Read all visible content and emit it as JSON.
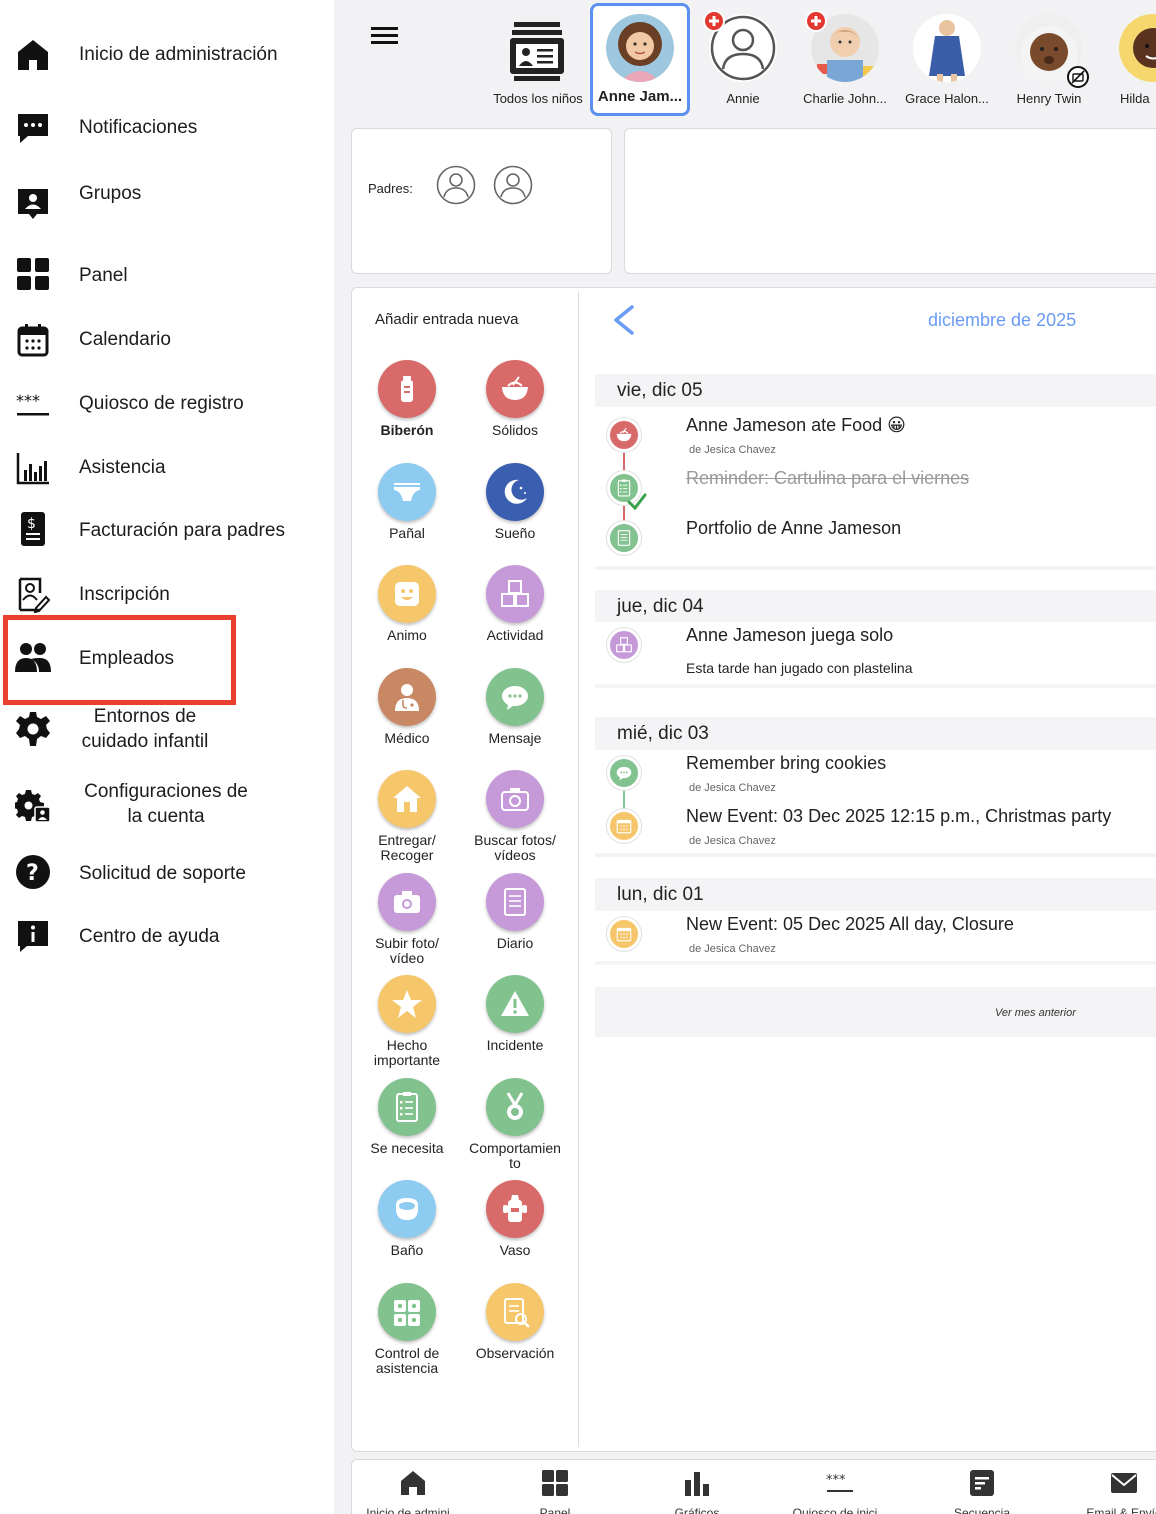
{
  "sidebar": {
    "items": [
      {
        "label": "Inicio de administración",
        "icon": "home-icon"
      },
      {
        "label": "Notificaciones",
        "icon": "chat-bubble-icon"
      },
      {
        "label": "Grupos",
        "icon": "group-badge-icon"
      },
      {
        "label": "Panel",
        "icon": "grid-icon"
      },
      {
        "label": "Calendario",
        "icon": "calendar-icon"
      },
      {
        "label": "Quiosco de registro",
        "icon": "asterisks-icon"
      },
      {
        "label": "Asistencia",
        "icon": "bar-chart-icon"
      },
      {
        "label": "Facturación para padres",
        "icon": "invoice-icon"
      },
      {
        "label": "Inscripción",
        "icon": "enrollment-icon"
      },
      {
        "label": "Empleados",
        "icon": "people-icon"
      },
      {
        "label_line1": "Entornos de",
        "label_line2": "cuidado infantil",
        "icon": "gear-icon"
      },
      {
        "label_line1": "Configuraciones de",
        "label_line2": "la cuenta",
        "icon": "account-settings-icon"
      },
      {
        "label": "Solicitud de soporte",
        "icon": "question-icon"
      },
      {
        "label": "Centro de ayuda",
        "icon": "info-icon"
      }
    ],
    "highlight_color": "#e8402c"
  },
  "children_bar": {
    "tabs": [
      {
        "name": "Todos los niños",
        "kind": "all"
      },
      {
        "name": "Anne Jam...",
        "kind": "photo",
        "selected": true
      },
      {
        "name": "Annie",
        "kind": "placeholder",
        "badge": true
      },
      {
        "name": "Charlie John...",
        "kind": "photo",
        "badge": true
      },
      {
        "name": "Grace Halon...",
        "kind": "photo"
      },
      {
        "name": "Henry Twin",
        "kind": "photo"
      },
      {
        "name": "Hilda",
        "kind": "photo"
      }
    ],
    "selected_color": "#5b8ff0"
  },
  "parents": {
    "label": "Padres:"
  },
  "add_entry": {
    "title": "Añadir entrada nueva",
    "items": [
      {
        "label": "Biberón",
        "color": "#d96a6a",
        "icon": "bottle-icon",
        "bold": true
      },
      {
        "label": "Sólidos",
        "color": "#d96a6a",
        "icon": "bowl-icon"
      },
      {
        "label": "Pañal",
        "color": "#8ecbf0",
        "icon": "diaper-icon"
      },
      {
        "label": "Sueño",
        "color": "#3a5fb0",
        "icon": "moon-icon"
      },
      {
        "label": "Animo",
        "color": "#f5c66a",
        "icon": "smile-icon"
      },
      {
        "label": "Actividad",
        "color": "#c69ad8",
        "icon": "blocks-icon"
      },
      {
        "label": "Médico",
        "color": "#c98864",
        "icon": "doctor-icon"
      },
      {
        "label": "Mensaje",
        "color": "#82c28e",
        "icon": "message-icon"
      },
      {
        "label_line1": "Entregar/",
        "label_line2": "Recoger",
        "color": "#f5c66a",
        "icon": "house-icon"
      },
      {
        "label_line1": "Buscar fotos/",
        "label_line2": "vídeos",
        "color": "#c69ad8",
        "icon": "camera-icon"
      },
      {
        "label_line1": "Subir foto/",
        "label_line2": "vídeo",
        "color": "#c69ad8",
        "icon": "camera-upload-icon"
      },
      {
        "label": "Diario",
        "color": "#c69ad8",
        "icon": "journal-icon"
      },
      {
        "label_line1": "Hecho",
        "label_line2": "importante",
        "color": "#f5c66a",
        "icon": "star-icon"
      },
      {
        "label": "Incidente",
        "color": "#82c28e",
        "icon": "warning-icon"
      },
      {
        "label": "Se necesita",
        "color": "#82c28e",
        "icon": "checklist-icon"
      },
      {
        "label_line1": "Comportamien",
        "label_line2": "to",
        "color": "#82c28e",
        "icon": "medal-icon"
      },
      {
        "label": "Baño",
        "color": "#8ecbf0",
        "icon": "potty-icon"
      },
      {
        "label": "Vaso",
        "color": "#d96a6a",
        "icon": "sippy-cup-icon"
      },
      {
        "label_line1": "Control de",
        "label_line2": "asistencia",
        "color": "#82c28e",
        "icon": "attendance-icon"
      },
      {
        "label": "Observación",
        "color": "#f5c66a",
        "icon": "observation-icon"
      }
    ]
  },
  "timeline": {
    "month": "diciembre de 2025",
    "days": [
      {
        "header": "vie, dic 05",
        "events": [
          {
            "title": "Anne Jameson ate Food 😀",
            "sub": "de Jesica Chavez",
            "color": "#d96a6a",
            "icon": "bowl-icon"
          },
          {
            "title": "Reminder: Cartulina para el viernes",
            "strike": true,
            "color": "#82c28e",
            "icon": "checklist-icon"
          },
          {
            "title": "Portfolio de Anne Jameson",
            "color": "#82c28e",
            "icon": "journal-icon"
          }
        ]
      },
      {
        "header": "jue, dic 04",
        "events": [
          {
            "title": "Anne Jameson juega solo",
            "desc": "Esta tarde han jugado con plastelina",
            "color": "#c69ad8",
            "icon": "blocks-icon"
          }
        ]
      },
      {
        "header": "mié, dic 03",
        "events": [
          {
            "title": "Remember bring cookies",
            "sub": "de Jesica Chavez",
            "color": "#82c28e",
            "icon": "message-icon"
          },
          {
            "title": "New Event: 03 Dec 2025 12:15 p.m., Christmas party",
            "sub": "de Jesica Chavez",
            "color": "#f5c66a",
            "icon": "calendar-icon"
          }
        ]
      },
      {
        "header": "lun, dic 01",
        "events": [
          {
            "title": "New Event: 05 Dec 2025 All day, Closure",
            "sub": "de Jesica Chavez",
            "color": "#f5c66a",
            "icon": "calendar-icon"
          }
        ]
      }
    ],
    "more_label": "Ver mes anterior"
  },
  "bottom_bar": {
    "tabs": [
      {
        "label": "Inicio de admini...",
        "icon": "home-icon"
      },
      {
        "label": "Panel",
        "icon": "grid-icon"
      },
      {
        "label": "Gráficos",
        "icon": "bar-chart-icon"
      },
      {
        "label": "Quiosco de inici...",
        "icon": "asterisks-icon"
      },
      {
        "label": "Secuencia",
        "icon": "document-icon"
      },
      {
        "label": "Email & Envío",
        "icon": "mail-icon"
      }
    ]
  }
}
